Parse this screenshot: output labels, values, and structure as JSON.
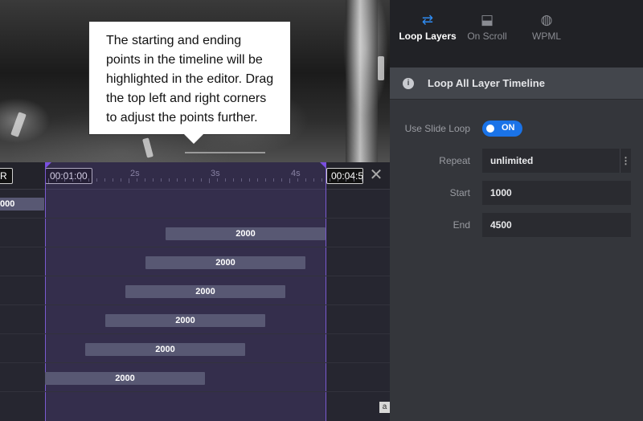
{
  "tooltip": {
    "text": "The starting and ending\npoints in the timeline will be\nhighlighted in the editor.  Drag\nthe top left and right corners\nto adjust the points further."
  },
  "timeline": {
    "left_time_partial": "R",
    "start_time": "00:01:00",
    "end_time": "00:04:5",
    "tick_labels": [
      "2s",
      "3s",
      "4s"
    ],
    "top_partial_bar": "000",
    "bars": [
      {
        "label": "2000"
      },
      {
        "label": "2000"
      },
      {
        "label": "2000"
      },
      {
        "label": "2000"
      },
      {
        "label": "2000"
      },
      {
        "label": "2000"
      }
    ],
    "corner_box": "a"
  },
  "panel": {
    "tabs": [
      {
        "label": "Loop Layers",
        "icon": "loop-icon",
        "active": true
      },
      {
        "label": "On Scroll",
        "icon": "scroll-download-icon",
        "active": false
      },
      {
        "label": "WPML",
        "icon": "globe-icon",
        "active": false
      }
    ],
    "section_title": "Loop All Layer Timeline",
    "use_slide_loop": {
      "label": "Use Slide Loop",
      "value": "ON"
    },
    "repeat": {
      "label": "Repeat",
      "value": "unlimited"
    },
    "start": {
      "label": "Start",
      "value": "1000"
    },
    "end": {
      "label": "End",
      "value": "4500"
    },
    "accent_color": "#1a73e8",
    "loop_region_color": "#7a4fe0"
  }
}
